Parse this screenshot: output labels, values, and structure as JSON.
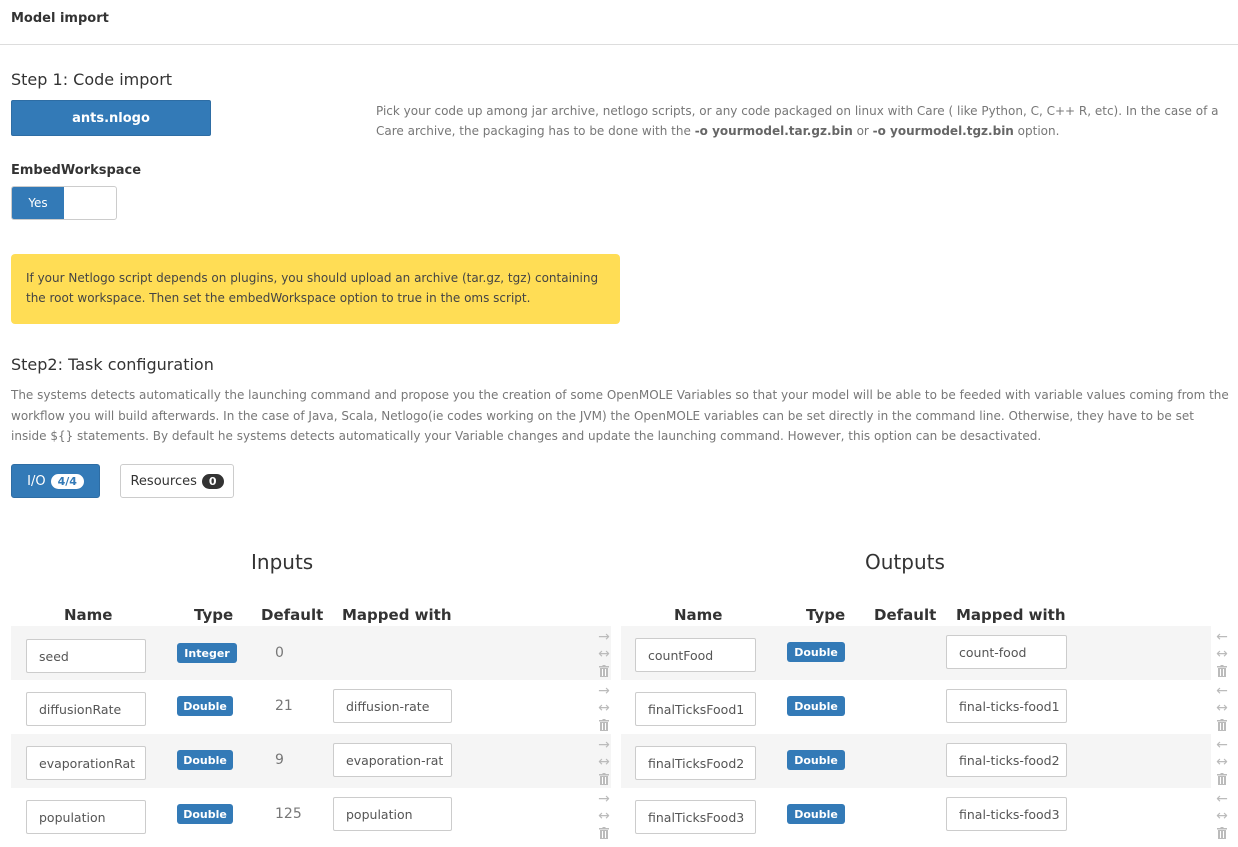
{
  "header": {
    "title": "Model import"
  },
  "step1": {
    "title": "Step 1: Code import",
    "file_button": "ants.nlogo",
    "help_part1": "Pick your code up among jar archive, netlogo scripts, or any code packaged on linux with Care ( like Python, C, C++ R, etc). In the case of a Care archive, the packaging has to be done with the ",
    "help_code1": "-o yourmodel.tar.gz.bin",
    "help_part2": " or ",
    "help_code2": "-o yourmodel.tgz.bin",
    "help_part3": " option.",
    "embed_label": "EmbedWorkspace",
    "toggle_on_label": "Yes",
    "warning": "If your Netlogo script depends on plugins, you should upload an archive (tar.gz, tgz) containing the root workspace. Then set the embedWorkspace option to true in the oms script."
  },
  "step2": {
    "title": "Step2: Task configuration",
    "description": "The systems detects automatically the launching command and propose you the creation of some OpenMOLE Variables so that your model will be able to be feeded with variable values coming from the workflow you will build afterwards. In the case of Java, Scala, Netlogo(ie codes working on the JVM) the OpenMOLE variables can be set directly in the command line. Otherwise, they have to be set inside ${} statements. By default he systems detects automatically your Variable changes and update the launching command. However, this option can be desactivated."
  },
  "tabs": {
    "io_label": "I/O",
    "io_badge": "4/4",
    "resources_label": "Resources",
    "resources_badge": "0"
  },
  "inputs": {
    "title": "Inputs",
    "headers": {
      "name": "Name",
      "type": "Type",
      "default": "Default",
      "mapped": "Mapped with"
    },
    "rows": [
      {
        "name": "seed",
        "type": "Integer",
        "default": "0",
        "mapped": ""
      },
      {
        "name": "diffusionRate",
        "type": "Double",
        "default": "21",
        "mapped": "diffusion-rate"
      },
      {
        "name": "evaporationRat",
        "type": "Double",
        "default": "9",
        "mapped": "evaporation-rat"
      },
      {
        "name": "population",
        "type": "Double",
        "default": "125",
        "mapped": "population"
      }
    ]
  },
  "outputs": {
    "title": "Outputs",
    "headers": {
      "name": "Name",
      "type": "Type",
      "default": "Default",
      "mapped": "Mapped with"
    },
    "rows": [
      {
        "name": "countFood",
        "type": "Double",
        "default": "",
        "mapped": "count-food"
      },
      {
        "name": "finalTicksFood1",
        "type": "Double",
        "default": "",
        "mapped": "final-ticks-food1"
      },
      {
        "name": "finalTicksFood2",
        "type": "Double",
        "default": "",
        "mapped": "final-ticks-food2"
      },
      {
        "name": "finalTicksFood3",
        "type": "Double",
        "default": "",
        "mapped": "final-ticks-food3"
      }
    ]
  },
  "icons": {
    "to_output": "→",
    "to_input": "←",
    "swap": "↔"
  },
  "colors": {
    "primary": "#337ab7",
    "warning": "#ffdd55",
    "row_shade": "#f5f5f5"
  }
}
